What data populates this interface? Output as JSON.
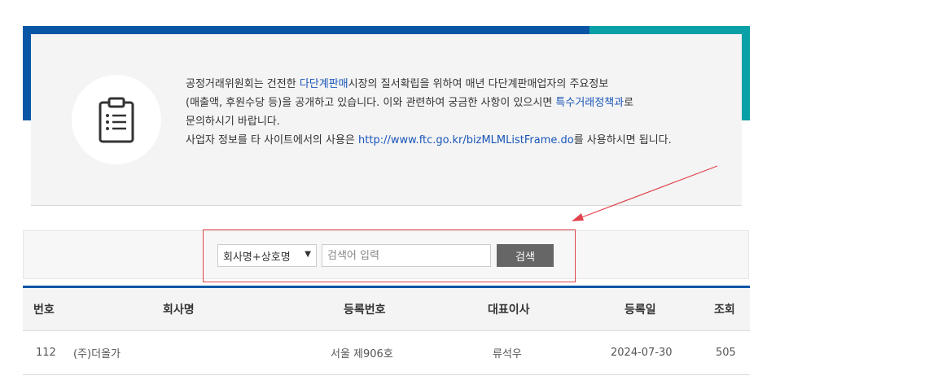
{
  "notice": {
    "line1_pre": "공정거래위원회는 건전한 ",
    "line1_link": "다단계판매",
    "line1_post": "시장의 질서확립을 위하여 매년 다단계판매업자의 주요정보",
    "line2_pre": "(매출액, 후원수당 등)을 공개하고 있습니다. 이와 관련하여 궁금한 사항이 있으시면 ",
    "line2_link": "특수거래정책과",
    "line2_post": "로",
    "line3": "문의하시기 바랍니다.",
    "line4_pre": "사업자 정보를 타 사이트에서의 사용은 ",
    "line4_link": "http://www.ftc.go.kr/bizMLMListFrame.do",
    "line4_post": "를 사용하시면 됩니다.",
    "icon": "clipboard-list-icon"
  },
  "search": {
    "select_value": "회사명+상호명",
    "placeholder": "검색어 입력",
    "button_label": "검색"
  },
  "table": {
    "headers": {
      "no": "번호",
      "company": "회사명",
      "reg_no": "등록번호",
      "ceo": "대표이사",
      "reg_date": "등록일",
      "views": "조회"
    },
    "rows": [
      {
        "no": "112",
        "company": "(주)더올가",
        "reg_no": "서울 제906호",
        "ceo": "류석우",
        "reg_date": "2024-07-30",
        "views": "505"
      }
    ]
  },
  "colors": {
    "brand_blue": "#0a56a6",
    "teal": "#0aa0a8",
    "highlight_red": "#e0454f",
    "link": "#1a55b8"
  }
}
